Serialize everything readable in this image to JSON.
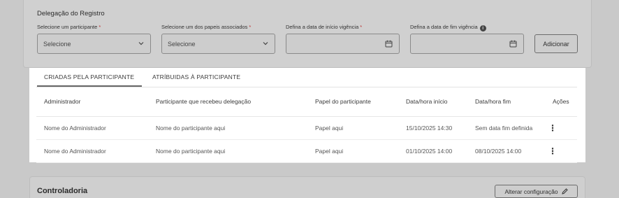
{
  "delegation": {
    "title": "Delegação do Registro",
    "fields": [
      {
        "label": "Selecione um participante",
        "required": "*",
        "value": "Selecione"
      },
      {
        "label": "Selecione um dos papeis associados",
        "required": "*",
        "value": "Selecione"
      },
      {
        "label": "Defina a data de início vigência",
        "required": "*",
        "value": ""
      },
      {
        "label": "Defina a data de fim vigência",
        "info": "i",
        "value": ""
      }
    ],
    "add_label": "Adicionar"
  },
  "tabs": [
    {
      "label": "CRIADAS PELA PARTICIPANTE",
      "active": true
    },
    {
      "label": "ATRÍBUIDAS À PARTICIPANTE",
      "active": false
    }
  ],
  "table": {
    "headers": [
      "Administrador",
      "Participante que recebeu delegação",
      "Papel do participante",
      "Data/hora início",
      "Data/hora fim",
      "Ações"
    ],
    "rows": [
      [
        "Nome do Administrador",
        "Nome do participante aqui",
        "Papel aqui",
        "15/10/2025 14:30",
        "Sem data fim definida",
        "⋮"
      ],
      [
        "Nome do Administrador",
        "Nome do participante aqui",
        "Papel aqui",
        "01/10/2025 14:00",
        "08/10/2025 14:00",
        "⋮"
      ]
    ]
  },
  "controladoria": {
    "title": "Controladoria",
    "button_label": "Alterar configuração"
  },
  "icons": {
    "chevron": "chevron-down-icon",
    "calendar": "calendar-icon",
    "info": "info-icon",
    "kebab": "kebab-menu-icon",
    "pencil": "pencil-icon"
  }
}
